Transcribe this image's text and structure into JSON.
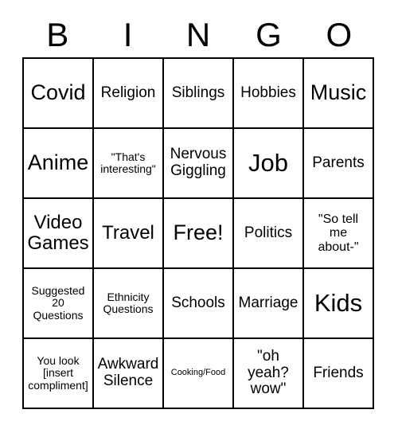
{
  "card": {
    "title_letters": [
      "B",
      "I",
      "N",
      "G",
      "O"
    ],
    "grid": {
      "rows": 5,
      "columns": 5,
      "border_color": "#000000",
      "cell_background": "#ffffff",
      "text_color": "#000000"
    },
    "cells": [
      {
        "text": "Covid",
        "size": "xl"
      },
      {
        "text": "Religion",
        "size": "md"
      },
      {
        "text": "Siblings",
        "size": "md"
      },
      {
        "text": "Hobbies",
        "size": "md"
      },
      {
        "text": "Music",
        "size": "xl"
      },
      {
        "text": "Anime",
        "size": "xl"
      },
      {
        "text": "\"That's\ninteresting\"",
        "size": "xs"
      },
      {
        "text": "Nervous\nGiggling",
        "size": "md"
      },
      {
        "text": "Job",
        "size": "xxl"
      },
      {
        "text": "Parents",
        "size": "md"
      },
      {
        "text": "Video\nGames",
        "size": "lg"
      },
      {
        "text": "Travel",
        "size": "lg"
      },
      {
        "text": "Free!",
        "size": "xl"
      },
      {
        "text": "Politics",
        "size": "md"
      },
      {
        "text": "\"So tell\nme\nabout-\"",
        "size": "sm"
      },
      {
        "text": "Suggested\n20\nQuestions",
        "size": "xs"
      },
      {
        "text": "Ethnicity\nQuestions",
        "size": "xs"
      },
      {
        "text": "Schools",
        "size": "md"
      },
      {
        "text": "Marriage",
        "size": "md"
      },
      {
        "text": "Kids",
        "size": "xxl"
      },
      {
        "text": "You look\n[insert\ncompliment]",
        "size": "xs"
      },
      {
        "text": "Awkward\nSilence",
        "size": "md"
      },
      {
        "text": "Cooking/Food",
        "size": "xxs"
      },
      {
        "text": "\"oh\nyeah?\nwow\"",
        "size": "md"
      },
      {
        "text": "Friends",
        "size": "md"
      }
    ]
  }
}
